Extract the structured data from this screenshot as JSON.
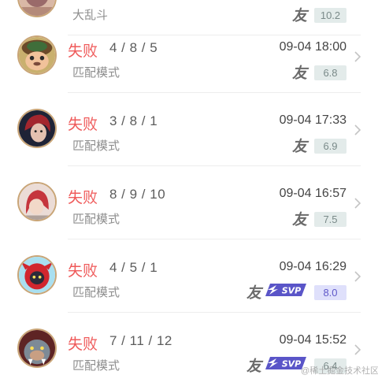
{
  "matches": [
    {
      "champion": "champion-portrait-top",
      "result": "",
      "kda": "",
      "mode": "大乱斗",
      "time": "",
      "friend_badge": "友",
      "svp": false,
      "score": "10.2",
      "score_style": "normal"
    },
    {
      "champion": "teemo-portrait",
      "result": "失败",
      "kda": "4 / 8 / 5",
      "mode": "匹配模式",
      "time": "09-04 18:00",
      "friend_badge": "友",
      "svp": false,
      "score": "6.8",
      "score_style": "normal"
    },
    {
      "champion": "red-hair-champion-portrait",
      "result": "失败",
      "kda": "3 / 8 / 1",
      "mode": "匹配模式",
      "time": "09-04 17:33",
      "friend_badge": "友",
      "svp": false,
      "score": "6.9",
      "score_style": "normal"
    },
    {
      "champion": "red-champion-portrait",
      "result": "失败",
      "kda": "8 / 9 / 10",
      "mode": "匹配模式",
      "time": "09-04 16:57",
      "friend_badge": "友",
      "svp": false,
      "score": "7.5",
      "score_style": "normal"
    },
    {
      "champion": "red-mask-champion-portrait",
      "result": "失败",
      "kda": "4 / 5 / 1",
      "mode": "匹配模式",
      "time": "09-04 16:29",
      "friend_badge": "友",
      "svp": true,
      "svp_label": "SVP",
      "score": "8.0",
      "score_style": "mvp"
    },
    {
      "champion": "beast-champion-portrait",
      "result": "失败",
      "kda": "7 / 11 / 12",
      "mode": "匹配模式",
      "time": "09-04 15:52",
      "friend_badge": "友",
      "svp": true,
      "svp_label": "SVP",
      "score": "6.4",
      "score_style": "normal"
    }
  ],
  "watermark": "@稀土掘金技术社区",
  "colors": {
    "result_loss": "#ef5a5a",
    "score_bg": "#e3ebea",
    "score_mvp_bg": "#dfe0fb",
    "svp_badge": "#5a55c8",
    "avatar_ring": "#c9a577"
  }
}
